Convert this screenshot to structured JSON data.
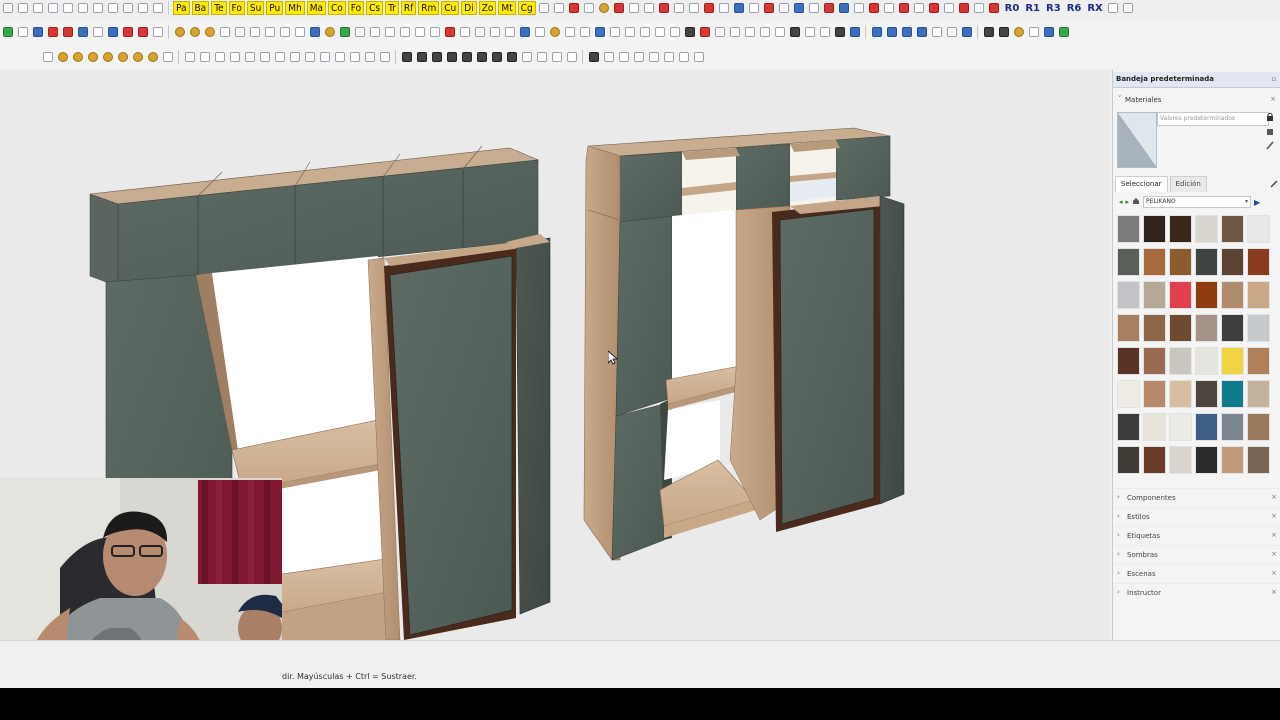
{
  "toolbar_top": {
    "yellow_tags": [
      "Pa",
      "Ba",
      "Te",
      "Fo",
      "Su",
      "Pu",
      "Mh",
      "Ma",
      "Co",
      "Fo",
      "Cs",
      "Tr",
      "Rf",
      "Rm",
      "Cu",
      "Di",
      "Zo",
      "Mt",
      "Cg"
    ],
    "right_tags": [
      "R0",
      "R1",
      "R3",
      "R6",
      "RX"
    ]
  },
  "tray": {
    "title": "Bandeja predeterminada",
    "materials_header": "Materiales",
    "material_name_placeholder": "Valores predeterminados",
    "tabs": [
      "Seleccionar",
      "Edición"
    ],
    "library": "PELIKANO",
    "swatch_colors": [
      "#7b7b7b",
      "#2f231c",
      "#3a261a",
      "#d9d5cf",
      "#6e5644",
      "#e9e8e6",
      "#5a5f5a",
      "#a66a3c",
      "#8a5c30",
      "#404441",
      "#5b4232",
      "#8a3c1e",
      "#c1c3c7",
      "#b5a896",
      "#e3404f",
      "#8e3b0f",
      "#b08c6c",
      "#c9a787",
      "#a9805f",
      "#8c6749",
      "#6d4a30",
      "#a5938a",
      "#3e3e40",
      "#c5c9cc",
      "#5a3327",
      "#9a6a53",
      "#c9c6c0",
      "#e5e4de",
      "#f0d444",
      "#b08058",
      "#efece4",
      "#b5896a",
      "#d8bda0",
      "#4f4540",
      "#0f7a8c",
      "#c4b39c",
      "#3c3b3c",
      "#e8e4da",
      "#ecebe8",
      "#3e5f85",
      "#7d8791",
      "#9a7a5b",
      "#403a35",
      "#6a3b28",
      "#d9d4cd",
      "#2b2b2b",
      "#c09a7a",
      "#7a6555"
    ],
    "panels": [
      "Componentes",
      "Estilos",
      "Etiquetas",
      "Sombras",
      "Escenas",
      "Instructor"
    ]
  },
  "status": {
    "text": "dir. Mayúsculas + Ctrl = Sustraer."
  }
}
